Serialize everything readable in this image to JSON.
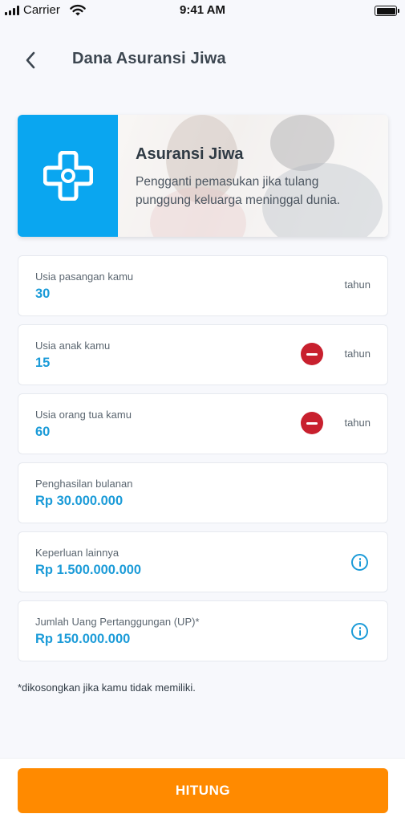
{
  "status_bar": {
    "carrier": "Carrier",
    "time": "9:41 AM"
  },
  "header": {
    "title": "Dana Asuransi Jiwa"
  },
  "banner": {
    "title": "Asuransi Jiwa",
    "description": "Pengganti pemasukan jika tulang punggung keluarga meninggal dunia.",
    "icon": "medical-cross-icon",
    "accent": "#0aa6f0"
  },
  "fields": [
    {
      "label": "Usia pasangan kamu",
      "value": "30",
      "unit": "tahun"
    },
    {
      "label": "Usia anak kamu",
      "value": "15",
      "unit": "tahun"
    },
    {
      "label": "Usia orang tua kamu",
      "value": "60",
      "unit": "tahun"
    },
    {
      "label": "Penghasilan bulanan",
      "value": "Rp 30.000.000"
    },
    {
      "label": "Keperluan lainnya",
      "value": "Rp 1.500.000.000"
    },
    {
      "label": "Jumlah Uang Pertanggungan (UP)*",
      "value": "Rp 150.000.000"
    }
  ],
  "note": "*dikosongkan jika kamu tidak memiliki.",
  "action": {
    "label": "HITUNG",
    "color": "#ff8a00"
  },
  "colors": {
    "value_blue": "#1b9bd8",
    "remove_red": "#c8202e"
  }
}
